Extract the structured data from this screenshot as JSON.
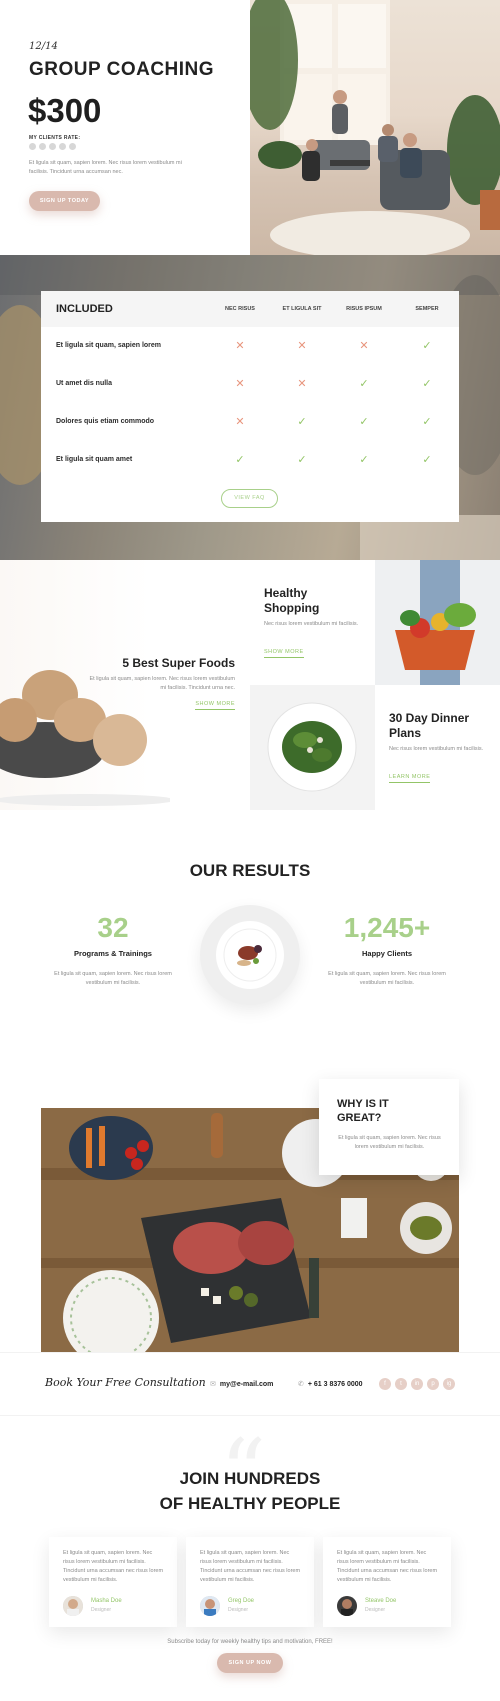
{
  "hero": {
    "date": "12/14",
    "title": "GROUP COACHING",
    "price": "$300",
    "clients_label": "MY CLIENTS RATE:",
    "rating": 0,
    "description": "Et ligula sit quam, sapien lorem. Nec risus lorem vestibulum mi facilisis. Tincidunt urna accumsan nec.",
    "button": "SIGN UP TODAY"
  },
  "included": {
    "title": "INCLUDED",
    "columns": [
      "NEC RISUS",
      "ET LIGULA SIT",
      "RISUS IPSUM",
      "SEMPER"
    ],
    "rows": [
      {
        "label": "Et ligula sit quam, sapien lorem",
        "marks": [
          false,
          false,
          false,
          true
        ]
      },
      {
        "label": "Ut amet dis nulla",
        "marks": [
          false,
          false,
          true,
          true
        ]
      },
      {
        "label": "Dolores quis etiam commodo",
        "marks": [
          false,
          true,
          true,
          true
        ]
      },
      {
        "label": "Et ligula sit quam amet",
        "marks": [
          true,
          true,
          true,
          true
        ]
      }
    ],
    "button": "VIEW FAQ"
  },
  "blog": {
    "left": {
      "title": "5 Best Super Foods",
      "text": "Et ligula sit quam, sapien lorem. Nec risus lorem vestibulum mi facilisis. Tincidunt urna nec.",
      "link": "SHOW MORE"
    },
    "top_right": {
      "title": "Healthy Shopping",
      "text": "Nec risus lorem vestibulum mi facilisis.",
      "link": "SHOW MORE"
    },
    "bottom_right": {
      "title": "30 Day Dinner Plans",
      "text": "Nec risus lorem vestibulum mi facilisis.",
      "link": "LEARN MORE"
    }
  },
  "results": {
    "title": "OUR RESULTS",
    "stats": [
      {
        "number": "32",
        "label": "Programs & Trainings",
        "text": "Et ligula sit quam, sapien lorem. Nec risus lorem vestibulum mi facilisis."
      },
      {
        "number": "1,245+",
        "label": "Happy Clients",
        "text": "Et ligula sit quam, sapien lorem. Nec risus lorem vestibulum mi facilisis."
      }
    ]
  },
  "why": {
    "title": "WHY IS IT GREAT?",
    "text": "Et ligula sit quam, sapien lorem. Nec risus lorem vestibulum mi facilisis."
  },
  "contact": {
    "book": "Book Your Free Consultation",
    "email": "my@e-mail.com",
    "phone": "+ 61 3 8376 0000",
    "email_icon": "envelope-icon",
    "phone_icon": "phone-icon",
    "socials": [
      "f",
      "t",
      "in",
      "p",
      "ig"
    ]
  },
  "testimonials": {
    "title_line1": "JOIN HUNDREDS",
    "title_line2": "OF HEALTHY PEOPLE",
    "items": [
      {
        "text": "Et ligula sit quam, sapien lorem. Nec risus lorem vestibulum mi facilisis. Tincidunt urna accumsan nec risus lorem vestibulum mi facilisis.",
        "name": "Masha Doe",
        "role": "Designer"
      },
      {
        "text": "Et ligula sit quam, sapien lorem. Nec risus lorem vestibulum mi facilisis. Tincidunt urna accumsan nec risus lorem vestibulum mi facilisis.",
        "name": "Greg Doe",
        "role": "Designer"
      },
      {
        "text": "Et ligula sit quam, sapien lorem. Nec risus lorem vestibulum mi facilisis. Tincidunt urna accumsan nec risus lorem vestibulum mi facilisis.",
        "name": "Steave Doe",
        "role": "Designer"
      }
    ],
    "subscribe": "Subscribe today for weekly healthy tips and motivation, FREE!",
    "button": "SIGN UP NOW"
  },
  "colors": {
    "accent_green": "#93c567",
    "accent_pink": "#d9b9ae",
    "cross": "#e8957d"
  }
}
